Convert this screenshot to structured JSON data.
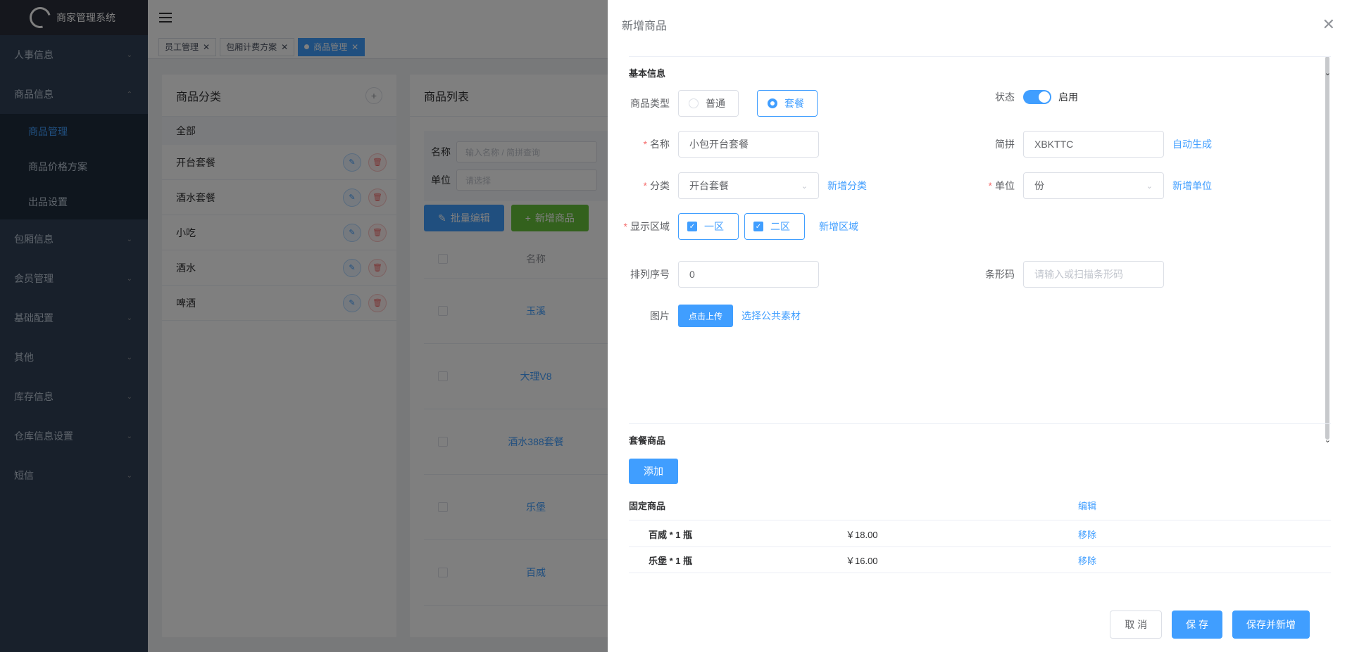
{
  "app": {
    "title": "商家管理系统"
  },
  "sidebar": {
    "menus": [
      {
        "label": "人事信息"
      },
      {
        "label": "商品信息"
      },
      {
        "label": "包厢信息"
      },
      {
        "label": "会员管理"
      },
      {
        "label": "基础配置"
      },
      {
        "label": "其他"
      },
      {
        "label": "库存信息"
      },
      {
        "label": "仓库信息设置"
      },
      {
        "label": "短信"
      }
    ],
    "submenu": [
      {
        "label": "商品管理"
      },
      {
        "label": "商品价格方案"
      },
      {
        "label": "出品设置"
      }
    ]
  },
  "tags": [
    {
      "label": "员工管理"
    },
    {
      "label": "包厢计费方案"
    },
    {
      "label": "商品管理"
    }
  ],
  "category": {
    "title": "商品分类",
    "all": "全部",
    "items": [
      {
        "label": "开台套餐"
      },
      {
        "label": "酒水套餐"
      },
      {
        "label": "小吃"
      },
      {
        "label": "酒水"
      },
      {
        "label": "啤酒"
      }
    ]
  },
  "productList": {
    "title": "商品列表",
    "filter": {
      "name_label": "名称",
      "name_placeholder": "输入名称 / 简拼查询",
      "unit_label": "单位",
      "unit_placeholder": "请选择"
    },
    "batch_edit": "批量编辑",
    "add_product": "新增商品",
    "col_name": "名称",
    "rows": [
      {
        "name": "玉溪"
      },
      {
        "name": "大理V8"
      },
      {
        "name": "酒水388套餐"
      },
      {
        "name": "乐堡"
      },
      {
        "name": "百威"
      }
    ]
  },
  "drawer": {
    "title": "新增商品",
    "basic_section": "基本信息",
    "type_label": "商品类型",
    "type_options": [
      "普通",
      "套餐"
    ],
    "status_label": "状态",
    "status_value": "启用",
    "name_label": "名称",
    "name_value": "小包开台套餐",
    "pinyin_label": "简拼",
    "pinyin_value": "XBKTTC",
    "auto_gen": "自动生成",
    "category_label": "分类",
    "category_value": "开台套餐",
    "add_category": "新增分类",
    "unit_label": "单位",
    "unit_value": "份",
    "add_unit": "新增单位",
    "area_label": "显示区域",
    "areas": [
      "一区",
      "二区"
    ],
    "add_area": "新增区域",
    "sort_label": "排列序号",
    "sort_value": "0",
    "barcode_label": "条形码",
    "barcode_placeholder": "请输入或扫描条形码",
    "image_label": "图片",
    "upload": "点击上传",
    "public_material": "选择公共素材",
    "combo_section": "套餐商品",
    "add": "添加",
    "fixed_title": "固定商品",
    "edit": "编辑",
    "fixed_items": [
      {
        "name": "百威 * 1 瓶",
        "price": "￥18.00",
        "action": "移除"
      },
      {
        "name": "乐堡 * 1 瓶",
        "price": "￥16.00",
        "action": "移除"
      }
    ],
    "cancel": "取 消",
    "save": "保 存",
    "save_new": "保存并新增"
  }
}
